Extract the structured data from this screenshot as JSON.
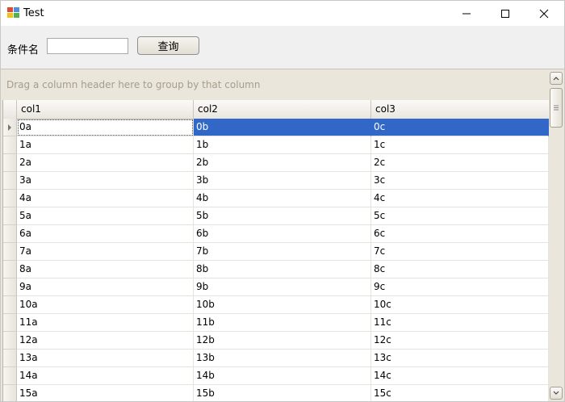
{
  "window": {
    "title": "Test"
  },
  "query": {
    "label": "条件名",
    "input_value": "",
    "button_label": "查询"
  },
  "grid": {
    "group_panel_text": "Drag a column header here to group by that column",
    "columns": [
      "col1",
      "col2",
      "col3"
    ],
    "selected_row": 0,
    "rows": [
      [
        "0a",
        "0b",
        "0c"
      ],
      [
        "1a",
        "1b",
        "1c"
      ],
      [
        "2a",
        "2b",
        "2c"
      ],
      [
        "3a",
        "3b",
        "3c"
      ],
      [
        "4a",
        "4b",
        "4c"
      ],
      [
        "5a",
        "5b",
        "5c"
      ],
      [
        "6a",
        "6b",
        "6c"
      ],
      [
        "7a",
        "7b",
        "7c"
      ],
      [
        "8a",
        "8b",
        "8c"
      ],
      [
        "9a",
        "9b",
        "9c"
      ],
      [
        "10a",
        "10b",
        "10c"
      ],
      [
        "11a",
        "11b",
        "11c"
      ],
      [
        "12a",
        "12b",
        "12c"
      ],
      [
        "13a",
        "13b",
        "13c"
      ],
      [
        "14a",
        "14b",
        "14c"
      ],
      [
        "15a",
        "15b",
        "15c"
      ]
    ]
  },
  "colors": {
    "selection": "#3168c7",
    "group_panel_bg": "#eae6dc"
  }
}
